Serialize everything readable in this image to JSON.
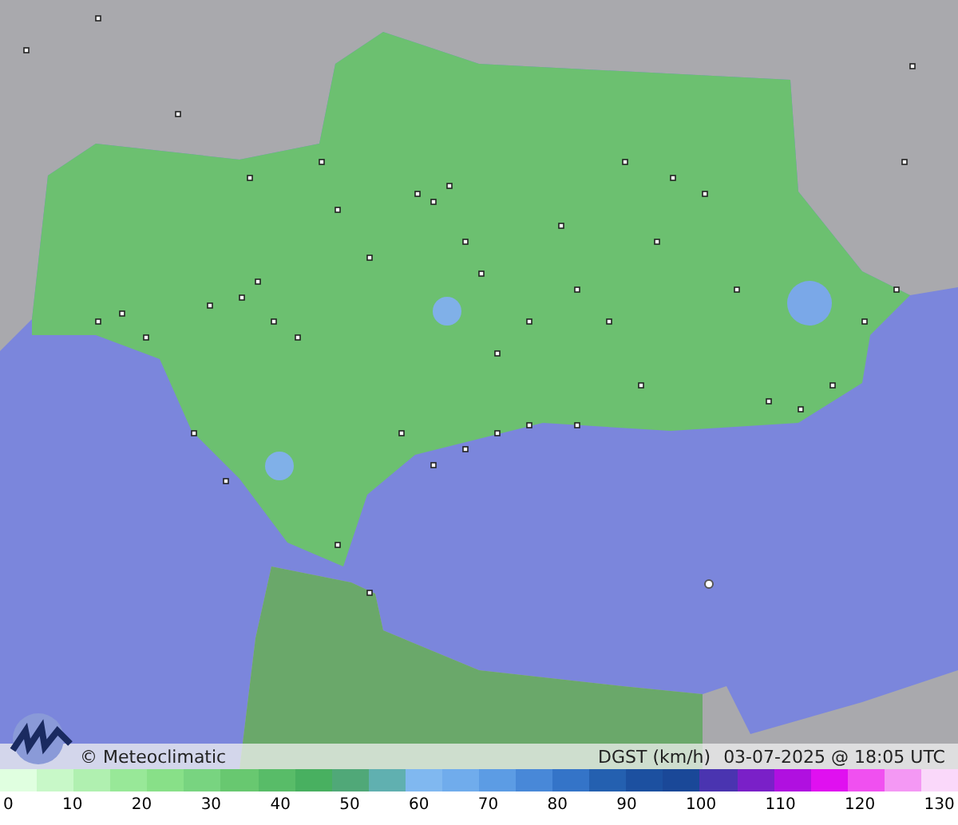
{
  "map": {
    "credit": "© Meteoclimatic",
    "variable": "DGST (km/h)",
    "timestamp": "03-07-2025 @ 18:05 UTC"
  },
  "legend": {
    "swatches": [
      {
        "color": "#e0ffe0"
      },
      {
        "color": "#c8f8c8"
      },
      {
        "color": "#b0f0b0"
      },
      {
        "color": "#98e898"
      },
      {
        "color": "#88e088"
      },
      {
        "color": "#78d480"
      },
      {
        "color": "#68c870"
      },
      {
        "color": "#58bc68"
      },
      {
        "color": "#48b060"
      },
      {
        "color": "#50a878"
      },
      {
        "color": "#60b0b0"
      },
      {
        "color": "#80b8f0"
      },
      {
        "color": "#70acec"
      },
      {
        "color": "#5c9ce4"
      },
      {
        "color": "#4888d8"
      },
      {
        "color": "#3474c8"
      },
      {
        "color": "#2460b0"
      },
      {
        "color": "#1c50a0"
      },
      {
        "color": "#1a4898"
      },
      {
        "color": "#4a34b0"
      },
      {
        "color": "#7a20c8"
      },
      {
        "color": "#b010e0"
      },
      {
        "color": "#e010f0"
      },
      {
        "color": "#f050f0"
      },
      {
        "color": "#f498f4"
      },
      {
        "color": "#fad8fa"
      }
    ],
    "ticks": [
      "0",
      "10",
      "20",
      "30",
      "40",
      "50",
      "60",
      "70",
      "80",
      "90",
      "100",
      "110",
      "120",
      "130"
    ]
  }
}
